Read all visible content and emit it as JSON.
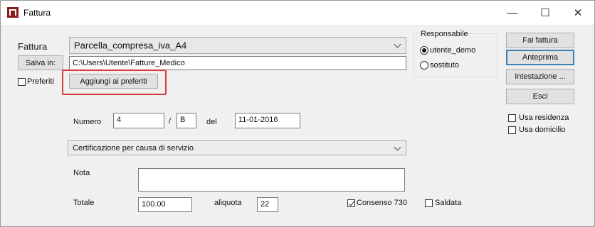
{
  "window": {
    "title": "Fattura",
    "minimize_glyph": "—",
    "maximize_glyph": "☐",
    "close_glyph": "✕"
  },
  "form": {
    "fattura_label": "Fattura",
    "template_value": "Parcella_compresa_iva_A4",
    "salva_in_button": "Salva in:",
    "path_value": "C:\\Users\\Utente\\Fatture_Medico",
    "preferiti_label": "Preferiti",
    "preferiti_checked": false,
    "aggiungi_button": "Aggiungi ai preferiti",
    "numero_label": "Numero",
    "numero_value": "4",
    "slash": "/",
    "serie_value": "B",
    "del_label": "del",
    "date_value": "11-01-2016",
    "causale_value": "Certificazione per causa di servizio",
    "nota_label": "Nota",
    "nota_value": "",
    "totale_label": "Totale",
    "totale_value": "100.00",
    "aliquota_label": "aliquota",
    "aliquota_value": "22",
    "consenso_label": "Consenso 730",
    "consenso_checked": true,
    "saldata_label": "Saldata",
    "saldata_checked": false
  },
  "responsabile": {
    "label": "Responsabile",
    "options": [
      "utente_demo",
      "sostituto"
    ],
    "selected": "utente_demo"
  },
  "actions": {
    "fai_fattura": "Fai fattura",
    "anteprima": "Anteprima",
    "intestazione": "Intestazione ...",
    "esci": "Esci",
    "usa_residenza": "Usa residenza",
    "usa_domicilio": "Usa domicilio"
  },
  "colors": {
    "highlight": "#d9383a",
    "accent": "#3c7fb1"
  }
}
